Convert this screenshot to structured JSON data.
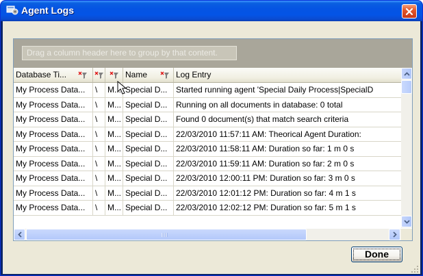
{
  "window": {
    "title": "Agent Logs",
    "title_icon": "agent-logs-icon",
    "close_icon": "close-icon"
  },
  "grid": {
    "group_hint": "Drag a column header here to group by that content.",
    "columns": [
      {
        "label": "Database Ti...",
        "filter_icon": "filter-icon"
      },
      {
        "label": "",
        "filter_icon": "filter-icon"
      },
      {
        "label": "",
        "filter_icon": "filter-icon"
      },
      {
        "label": "Name",
        "filter_icon": "filter-icon"
      },
      {
        "label": "Log Entry"
      }
    ],
    "rows": [
      [
        "My Process Data...",
        "\\",
        "M...",
        "Special D...",
        "Started running agent 'Special Daily Process|SpecialD"
      ],
      [
        "My Process Data...",
        "\\",
        "M...",
        "Special D...",
        "Running on all documents in database: 0 total"
      ],
      [
        "My Process Data...",
        "\\",
        "M...",
        "Special D...",
        "Found 0 document(s) that match search criteria"
      ],
      [
        "My Process Data...",
        "\\",
        "M...",
        "Special D...",
        "22/03/2010 11:57:11 AM: Theorical Agent Duration:"
      ],
      [
        "My Process Data...",
        "\\",
        "M...",
        "Special D...",
        "22/03/2010 11:58:11 AM: Duration so far: 1 m 0 s"
      ],
      [
        "My Process Data...",
        "\\",
        "M...",
        "Special D...",
        "22/03/2010 11:59:11 AM: Duration so far: 2 m 0 s"
      ],
      [
        "My Process Data...",
        "\\",
        "M...",
        "Special D...",
        "22/03/2010 12:00:11 PM: Duration so far: 3 m 0 s"
      ],
      [
        "My Process Data...",
        "\\",
        "M...",
        "Special D...",
        "22/03/2010 12:01:12 PM: Duration so far: 4 m 1 s"
      ],
      [
        "My Process Data...",
        "\\",
        "M...",
        "Special D...",
        "22/03/2010 12:02:12 PM: Duration so far: 5 m 1 s"
      ]
    ]
  },
  "buttons": {
    "done_label": "Done"
  },
  "colors": {
    "titlebar": "#0554e3",
    "close": "#e4572a",
    "group_area": "#a9a69a",
    "scrollbar": "#b7ccfb"
  }
}
